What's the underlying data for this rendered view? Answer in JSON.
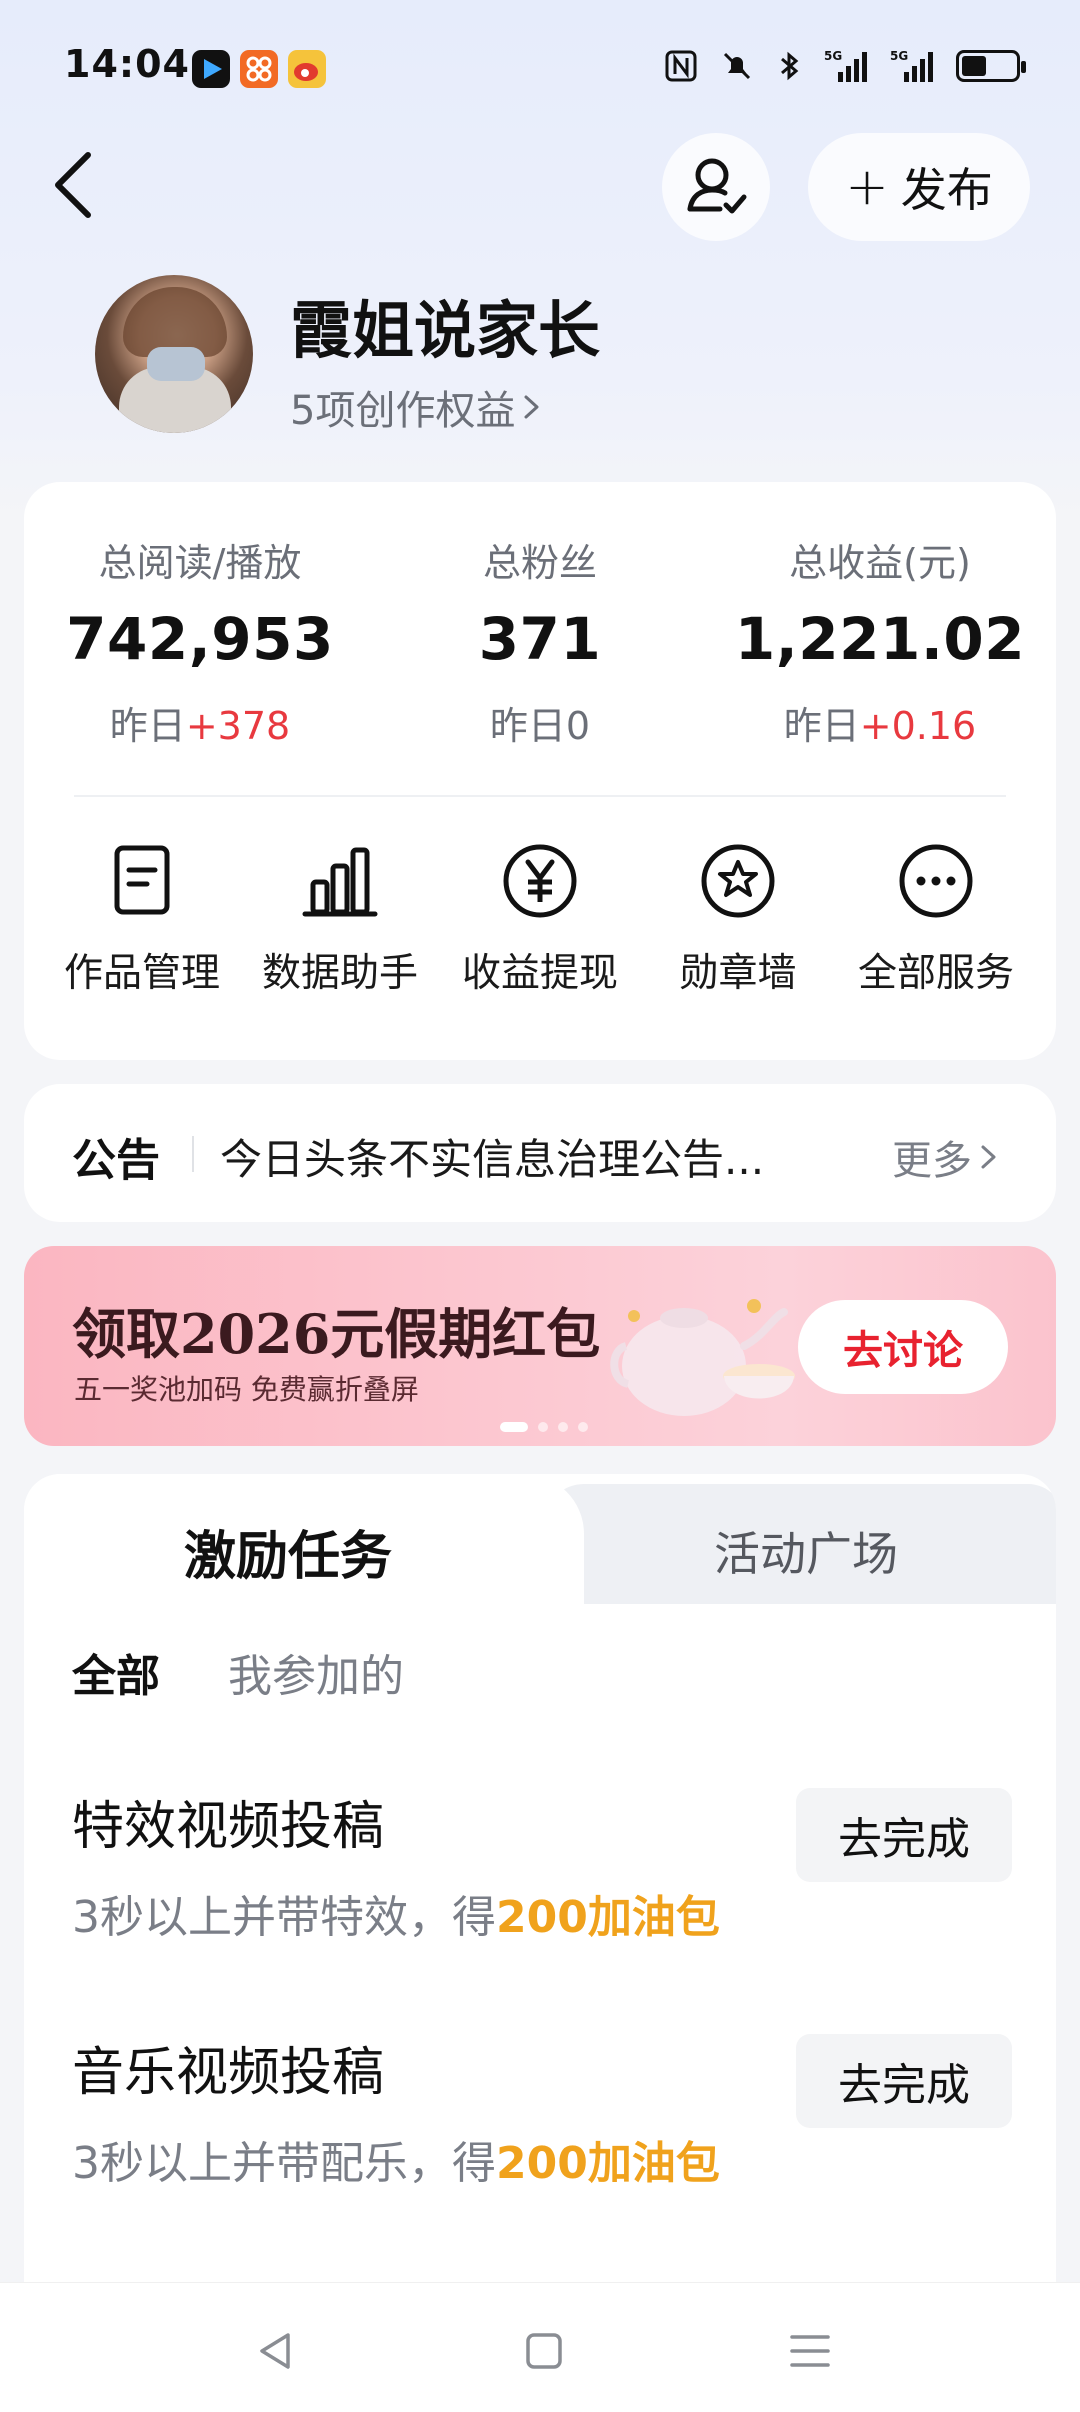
{
  "status_bar": {
    "time": "14:04",
    "apps": [
      {
        "icon": "video-app-icon",
        "color": "#1b5cff"
      },
      {
        "icon": "news-app-icon",
        "color": "#f26a24"
      },
      {
        "icon": "weibo-app-icon",
        "color": "#f5c33b"
      }
    ],
    "network_label": "5G",
    "battery_percent": 45
  },
  "nav": {
    "publish_label": "发布"
  },
  "profile": {
    "name": "霞姐说家长",
    "benefits_label": "5项创作权益"
  },
  "stats": [
    {
      "label": "总阅读/播放",
      "value": "742,953",
      "yesterday_prefix": "昨日",
      "delta": "+378"
    },
    {
      "label": "总粉丝",
      "value": "371",
      "yesterday_prefix": "昨日",
      "delta": "0"
    },
    {
      "label": "总收益(元)",
      "value": "1,221.02",
      "yesterday_prefix": "昨日",
      "delta": "+0.16"
    }
  ],
  "services": [
    {
      "label": "作品管理",
      "icon": "document-icon"
    },
    {
      "label": "数据助手",
      "icon": "bar-chart-icon"
    },
    {
      "label": "收益提现",
      "icon": "yuan-icon"
    },
    {
      "label": "勋章墙",
      "icon": "medal-icon"
    },
    {
      "label": "全部服务",
      "icon": "more-icon"
    }
  ],
  "notice": {
    "title": "公告",
    "text": "今日头条不实信息治理公告...",
    "more_label": "更多"
  },
  "banner": {
    "title": "领取2026元假期红包",
    "subtitle": "五一奖池加码 免费赢折叠屏",
    "button_label": "去讨论",
    "page_count": 4,
    "active_page": 1
  },
  "tasks": {
    "tabs": [
      "激励任务",
      "活动广场"
    ],
    "filters": [
      "全部",
      "我参加的"
    ],
    "items": [
      {
        "title": "特效视频投稿",
        "desc": "3秒以上并带特效，得",
        "reward": "200加油包",
        "button": "去完成"
      },
      {
        "title": "音乐视频投稿",
        "desc": "3秒以上并带配乐，得",
        "reward": "200加油包",
        "button": "去完成"
      }
    ]
  },
  "colors": {
    "accent_red": "#e8393f",
    "reward_orange": "#f0a21c",
    "banner_button_red": "#e8222f"
  }
}
